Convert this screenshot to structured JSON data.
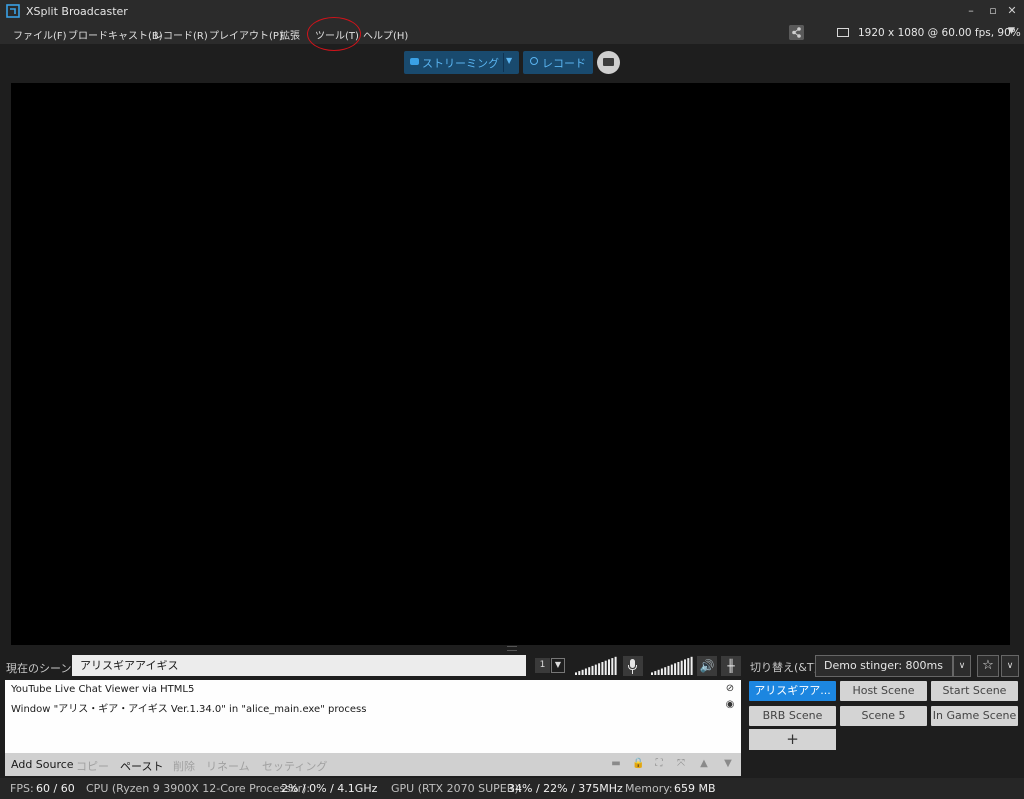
{
  "window": {
    "title": "XSplit Broadcaster",
    "controls": [
      "–",
      "▫",
      "✕"
    ]
  },
  "menu": {
    "items": [
      "ファイル(F)",
      "ブロードキャスト(B)",
      "レコード(R)",
      "プレイアウト(P)",
      "拡張",
      "ツール(T)",
      "ヘルプ(H)"
    ],
    "highlighted": "ツール(T)",
    "resolution": "1920 x 1080 @ 60.00 fps, 90%"
  },
  "toolbar": {
    "stream_label": "ストリーミング",
    "record_label": "レコード"
  },
  "scene": {
    "label": "現在のシーン",
    "name": "アリスギアアイギス",
    "layout_number": "1"
  },
  "audio": {
    "meter_levels": [
      2,
      3,
      4,
      5,
      6,
      7,
      8,
      9,
      10,
      11,
      12,
      13,
      14
    ]
  },
  "transition": {
    "label": "切り替え(&T)",
    "value": "Demo stinger: 800ms"
  },
  "sources": [
    {
      "name": "YouTube Live Chat Viewer via HTML5",
      "visible": false
    },
    {
      "name": "Window \"アリス・ギア・アイギス Ver.1.34.0\" in \"alice_main.exe\" process",
      "visible": true
    }
  ],
  "source_actions": {
    "add": "Add Source",
    "copy": "コピー",
    "paste": "ペースト",
    "delete": "削除",
    "rename": "リネーム",
    "settings": "セッティング"
  },
  "scene_buttons": [
    {
      "label": "アリスギアア...",
      "active": true
    },
    {
      "label": "Host Scene",
      "active": false
    },
    {
      "label": "Start Scene",
      "active": false
    },
    {
      "label": "BRB Scene",
      "active": false
    },
    {
      "label": "Scene 5",
      "active": false
    },
    {
      "label": "In Game Scene",
      "active": false
    }
  ],
  "add_scene_label": "+",
  "status": {
    "fps_label": "FPS:",
    "fps_value": "60 / 60",
    "cpu_label": "CPU (Ryzen 9 3900X 12-Core Processor):",
    "cpu_value": "2% / 0% / 4.1GHz",
    "gpu_label": "GPU (RTX 2070 SUPER):",
    "gpu_value": "34% / 22% / 375MHz",
    "memory_label": "Memory:",
    "memory_value": "659 MB"
  },
  "colors": {
    "accent": "#1c86e0",
    "stream_button": "#194a6e",
    "highlight_circle": "#d0131a"
  }
}
